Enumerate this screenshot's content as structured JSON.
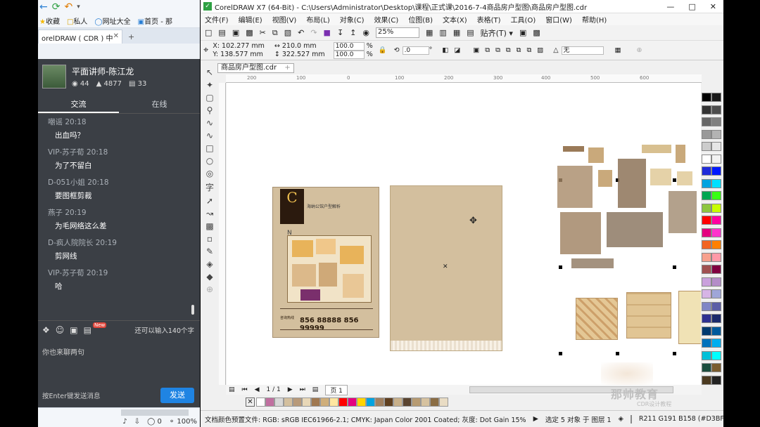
{
  "browser": {
    "fav_items": [
      "收藏",
      "私人",
      "网址大全",
      "首页 - 那"
    ],
    "tab_label": "orelDRAW ( CDR ) 中",
    "chat": {
      "teacher_name": "平面讲师-陈江龙",
      "stats": [
        "44",
        "4877",
        "33"
      ],
      "tabs": [
        "交流",
        "在线"
      ],
      "messages": [
        {
          "user": "嘲谣 20:18",
          "text": "出血吗？"
        },
        {
          "user": "VIP-苏子荀 20:18",
          "text": "为了不留白"
        },
        {
          "user": "D-051小姐 20:18",
          "text": "要图框剪裁"
        },
        {
          "user": "燕子 20:19",
          "text": "为毛网络这么差"
        },
        {
          "user": "D-疯人院院长 20:19",
          "text": "剪网线"
        },
        {
          "user": "VIP-苏子荀 20:19",
          "text": "哈"
        }
      ],
      "input_info": "还可以输入140个字",
      "new_badge": "New",
      "placeholder": "你也来聊两句",
      "hint": "按Enter键发送消息",
      "send_label": "发送"
    },
    "status": {
      "shield": "0",
      "zoom": "100%"
    }
  },
  "coreldraw": {
    "title": "CorelDRAW X7 (64-Bit) - C:\\Users\\Administrator\\Desktop\\课程\\正式课\\2016-7-4商品房户型图\\商品房户型图.cdr",
    "menu": [
      "文件(F)",
      "编辑(E)",
      "视图(V)",
      "布局(L)",
      "对象(C)",
      "效果(C)",
      "位图(B)",
      "文本(X)",
      "表格(T)",
      "工具(O)",
      "窗口(W)",
      "帮助(H)"
    ],
    "zoom": "25%",
    "snap": "贴齐(T)",
    "props": {
      "x": "X: 102.277 mm",
      "y": "Y: 138.577 mm",
      "w": "210.0 mm",
      "h": "322.527 mm",
      "sx": "100.0",
      "sy": "100.0",
      "pct": "%",
      "rot": ".0",
      "deg": "°",
      "outline": "无"
    },
    "doc_tab": "商品房户型图.cdr",
    "ruler_ticks": [
      "200",
      "100",
      "0",
      "100",
      "200",
      "300",
      "400",
      "500",
      "600"
    ],
    "page_nav": "1 / 1",
    "page_tab": "页 1",
    "poster": {
      "title": "海纳公馆户型解析",
      "phone": "856 88888   856 99999",
      "phone_label": "咨询热线"
    },
    "status": {
      "profile": "文档颜色预置文件: RGB: sRGB IEC61966-2.1; CMYK: Japan Color 2001 Coated; 灰度: Dot Gain 15%",
      "selection": "选定 5 对象 于 图层 1",
      "fill": "R211 G191 B158 (#D3BF9E)"
    },
    "watermark": "那帅教育",
    "watermark_sub": "CDR设计教程",
    "palette_colors": [
      "#000000",
      "#1a1a1a",
      "#333333",
      "#4d4d4d",
      "#666666",
      "#808080",
      "#999999",
      "#b3b3b3",
      "#cccccc",
      "#e6e6e6",
      "#ffffff",
      "#f2f2f2",
      "#1f2bd9",
      "#0018ff",
      "#00a3e0",
      "#00e0ff",
      "#00a651",
      "#39ff14",
      "#8dc63f",
      "#c8ff00",
      "#ff0000",
      "#ff00a0",
      "#e4007f",
      "#ff33cc",
      "#f26522",
      "#ff8000",
      "#f7a08d",
      "#ff9aa8",
      "#a05050",
      "#800040",
      "#c9a0dc",
      "#b48cc8",
      "#d6b4e6",
      "#9fa6d8",
      "#7f86c6",
      "#5b5ea6",
      "#2e3192",
      "#1b2a6b",
      "#003a70",
      "#005a9c",
      "#0072bc",
      "#00aeef",
      "#00c0d8",
      "#00ffff",
      "#1b4d3e",
      "#7a5c2e",
      "#4b3a20",
      "#222222"
    ],
    "swatches": [
      "#ffffff",
      "#c06fa0",
      "#d7d7d7",
      "#d3bf9e",
      "#b89a7a",
      "#e8d7b7",
      "#a07850",
      "#cfae7a",
      "#ffe6a0",
      "#ff0000",
      "#e4007f",
      "#ffd400",
      "#00a3e0",
      "#a08060",
      "#604020",
      "#c8b08a",
      "#5a4430",
      "#b79b72",
      "#d6c2a0",
      "#8a6d44",
      "#e9dcc4"
    ]
  }
}
